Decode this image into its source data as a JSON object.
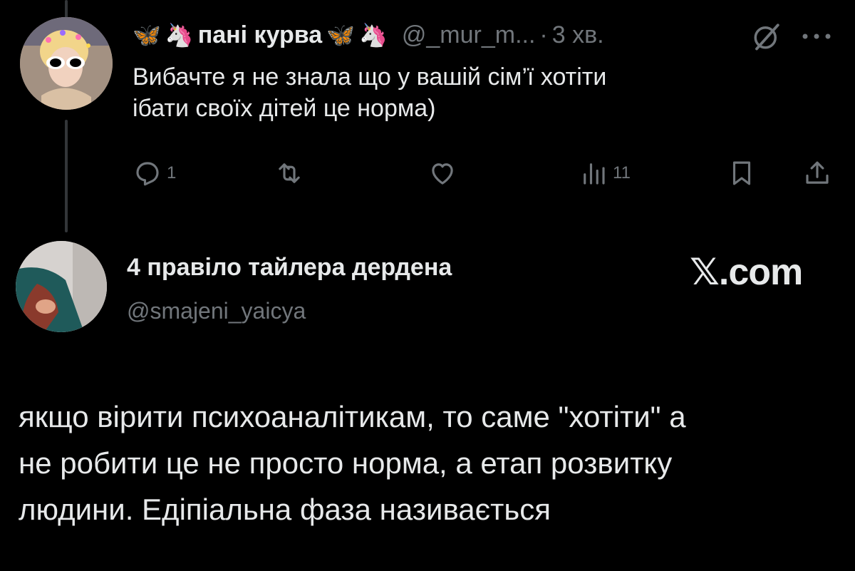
{
  "tweet": {
    "display_name": "пані курва",
    "decorations": [
      "🦋",
      "🦄"
    ],
    "handle": "@_mur_m...",
    "separator": "·",
    "timestamp": "3 хв.",
    "text": "Вибачте я не знала що у вашій сім’ї хотіти\nібати своїх дітей це норма)",
    "actions": {
      "replies": "1",
      "retweets": "",
      "likes": "",
      "views": "11"
    },
    "icons": [
      "grok-icon",
      "more-icon",
      "reply-icon",
      "retweet-icon",
      "like-icon",
      "views-icon",
      "bookmark-icon",
      "share-icon"
    ]
  },
  "quoted": {
    "display_name": "4 правіло тайлера дердена",
    "handle": "@smajeni_yaicya",
    "site": "𝕏.com",
    "text": "якщо вірити психоаналітикам, то саме \"хотіти\" а\nне робити це не просто норма, а етап розвитку\nлюдини. Едіпіальна фаза називається"
  },
  "colors": {
    "background": "#000000",
    "text": "#e7e9ea",
    "muted": "#71767b",
    "butterfly": "#4aa3ff"
  }
}
